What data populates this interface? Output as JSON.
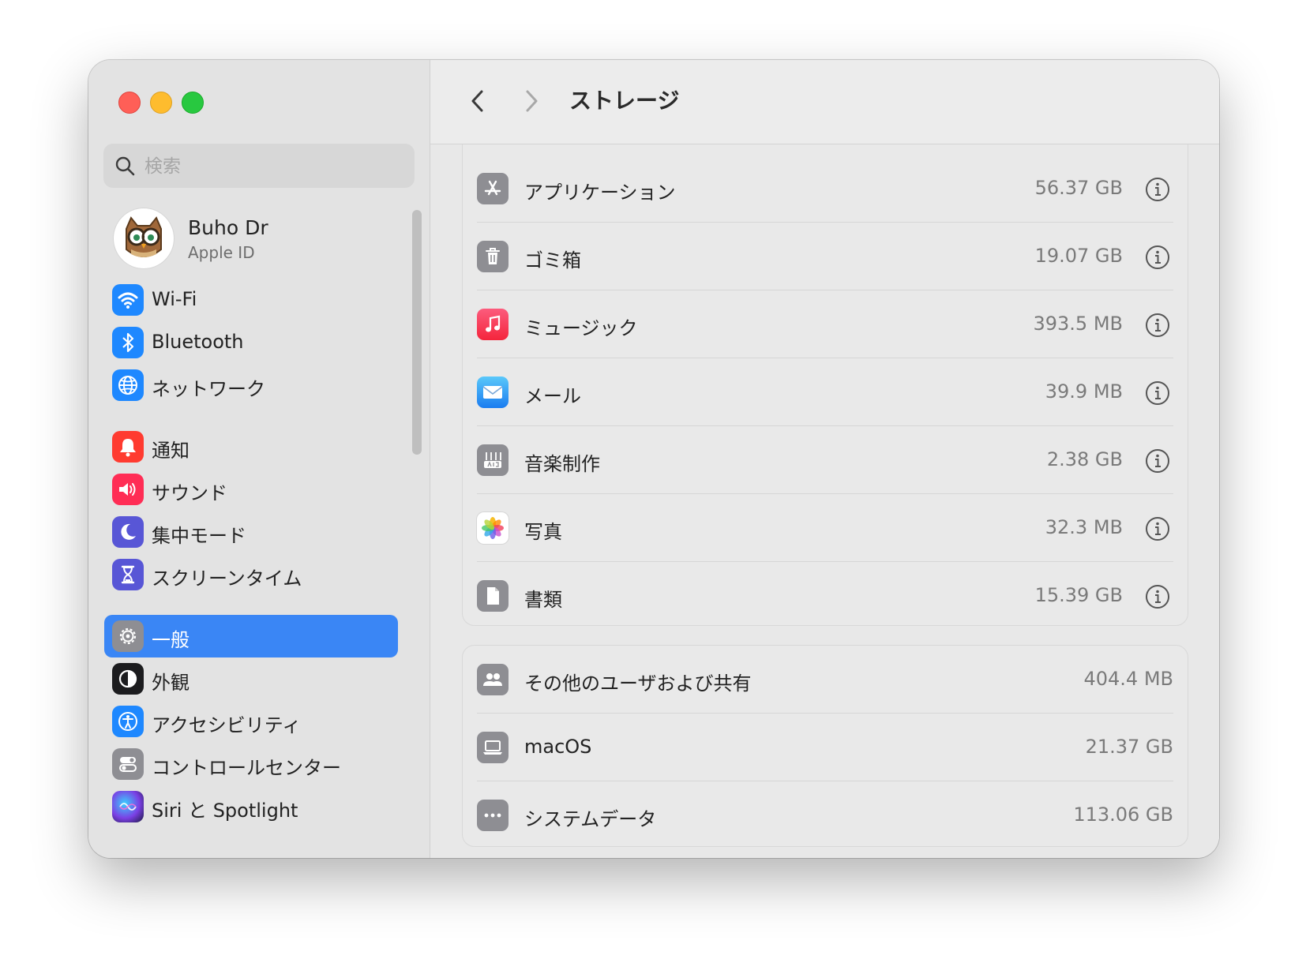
{
  "window": {
    "title": "ストレージ"
  },
  "search": {
    "placeholder": "検索"
  },
  "account": {
    "name": "Buho Dr",
    "subtitle": "Apple ID"
  },
  "sidebar": {
    "items": [
      {
        "label": "Wi-Fi",
        "icon": "wifi-icon",
        "color": "#1e88ff"
      },
      {
        "label": "Bluetooth",
        "icon": "bluetooth-icon",
        "color": "#1e88ff"
      },
      {
        "label": "ネットワーク",
        "icon": "globe-icon",
        "color": "#1e88ff"
      },
      {
        "label": "通知",
        "icon": "bell-icon",
        "color": "#ff3b30"
      },
      {
        "label": "サウンド",
        "icon": "speaker-icon",
        "color": "#ff2d55"
      },
      {
        "label": "集中モード",
        "icon": "moon-icon",
        "color": "#5856d6"
      },
      {
        "label": "スクリーンタイム",
        "icon": "hourglass-icon",
        "color": "#5856d6"
      },
      {
        "label": "一般",
        "icon": "gear-icon",
        "color": "#8e8e93",
        "selected": true
      },
      {
        "label": "外観",
        "icon": "appearance-icon",
        "color": "#1c1c1e"
      },
      {
        "label": "アクセシビリティ",
        "icon": "accessibility-icon",
        "color": "#1e88ff"
      },
      {
        "label": "コントロールセンター",
        "icon": "toggles-icon",
        "color": "#8e8e93"
      },
      {
        "label": "Siri と Spotlight",
        "icon": "siri-icon",
        "color": "#7b3fe4"
      }
    ]
  },
  "storage": {
    "apps": [
      {
        "label": "アプリケーション",
        "size": "56.37 GB",
        "icon": "app-store-icon"
      },
      {
        "label": "ゴミ箱",
        "size": "19.07 GB",
        "icon": "trash-icon"
      },
      {
        "label": "ミュージック",
        "size": "393.5 MB",
        "icon": "music-note-icon"
      },
      {
        "label": "メール",
        "size": "39.9 MB",
        "icon": "mail-envelope-icon"
      },
      {
        "label": "音楽制作",
        "size": "2.38 GB",
        "icon": "music-creation-icon"
      },
      {
        "label": "写真",
        "size": "32.3 MB",
        "icon": "photos-icon"
      },
      {
        "label": "書類",
        "size": "15.39 GB",
        "icon": "document-icon"
      }
    ],
    "system": [
      {
        "label": "その他のユーザおよび共有",
        "size": "404.4 MB",
        "icon": "users-icon"
      },
      {
        "label": "macOS",
        "size": "21.37 GB",
        "icon": "laptop-icon"
      },
      {
        "label": "システムデータ",
        "size": "113.06 GB",
        "icon": "ellipsis-icon"
      }
    ]
  }
}
